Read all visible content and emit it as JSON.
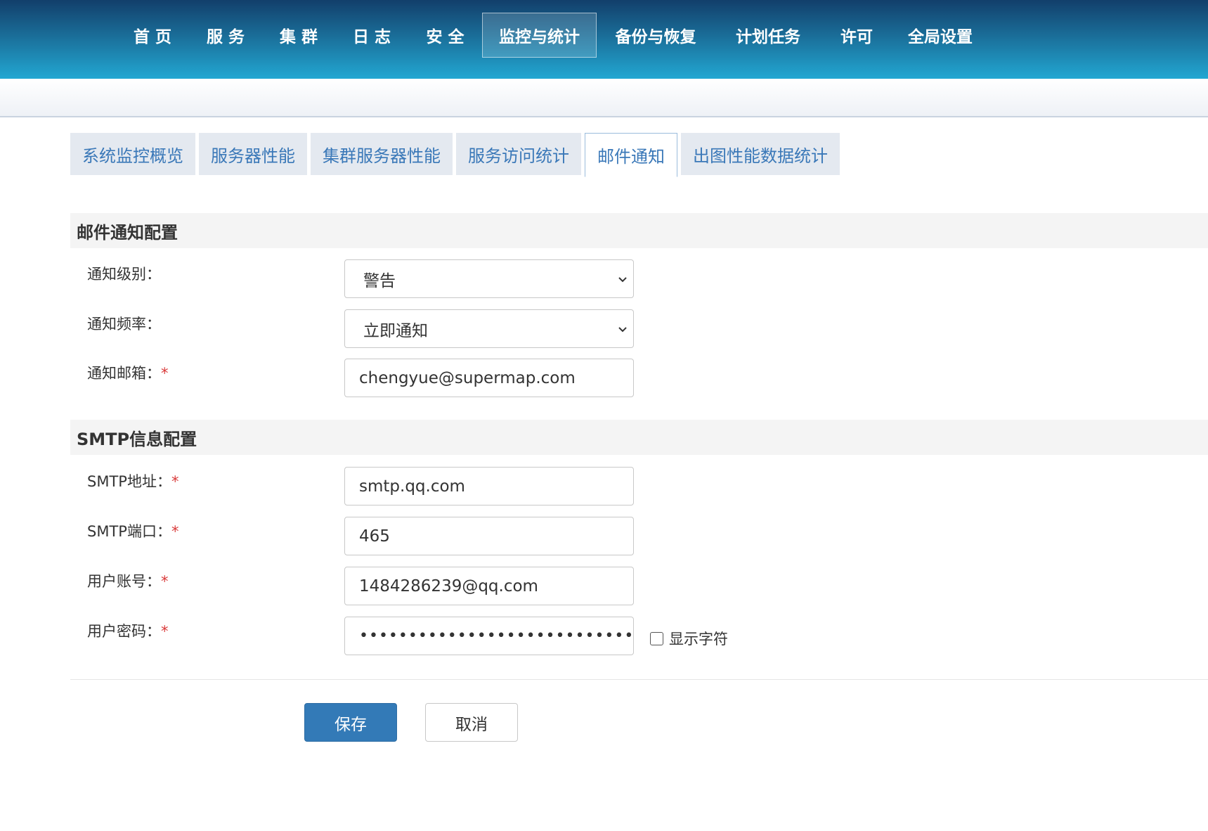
{
  "nav": {
    "items": [
      {
        "label": "首 页"
      },
      {
        "label": "服 务"
      },
      {
        "label": "集 群"
      },
      {
        "label": "日 志"
      },
      {
        "label": "安 全"
      },
      {
        "label": "监控与统计",
        "active": true
      },
      {
        "label": "备份与恢复"
      },
      {
        "label": "计划任务"
      },
      {
        "label": "许可"
      },
      {
        "label": "全局设置"
      }
    ]
  },
  "tabs": [
    {
      "label": "系统监控概览"
    },
    {
      "label": "服务器性能"
    },
    {
      "label": "集群服务器性能"
    },
    {
      "label": "服务访问统计"
    },
    {
      "label": "邮件通知",
      "active": true
    },
    {
      "label": "出图性能数据统计"
    }
  ],
  "mail_section": {
    "title": "邮件通知配置",
    "level": {
      "label": "通知级别：",
      "value": "警告"
    },
    "frequency": {
      "label": "通知频率：",
      "value": "立即通知"
    },
    "email": {
      "label": "通知邮箱：",
      "required": "*",
      "value": "chengyue@supermap.com"
    }
  },
  "smtp_section": {
    "title": "SMTP信息配置",
    "address": {
      "label": "SMTP地址：",
      "required": "*",
      "value": "smtp.qq.com"
    },
    "port": {
      "label": "SMTP端口：",
      "required": "*",
      "value": "465"
    },
    "account": {
      "label": "用户账号：",
      "required": "*",
      "value": "1484286239@qq.com"
    },
    "password": {
      "label": "用户密码：",
      "required": "*",
      "value": "••••••••••••••••••••••••••••",
      "show_chars_label": "显示字符",
      "show_chars_checked": false
    }
  },
  "actions": {
    "save_label": "保存",
    "cancel_label": "取消"
  },
  "colors": {
    "nav_gradient_top": "#123f6b",
    "nav_gradient_bottom": "#22a7d2",
    "tab_text": "#3a78b8",
    "primary_button": "#337ab7",
    "required": "#d93a3a"
  }
}
